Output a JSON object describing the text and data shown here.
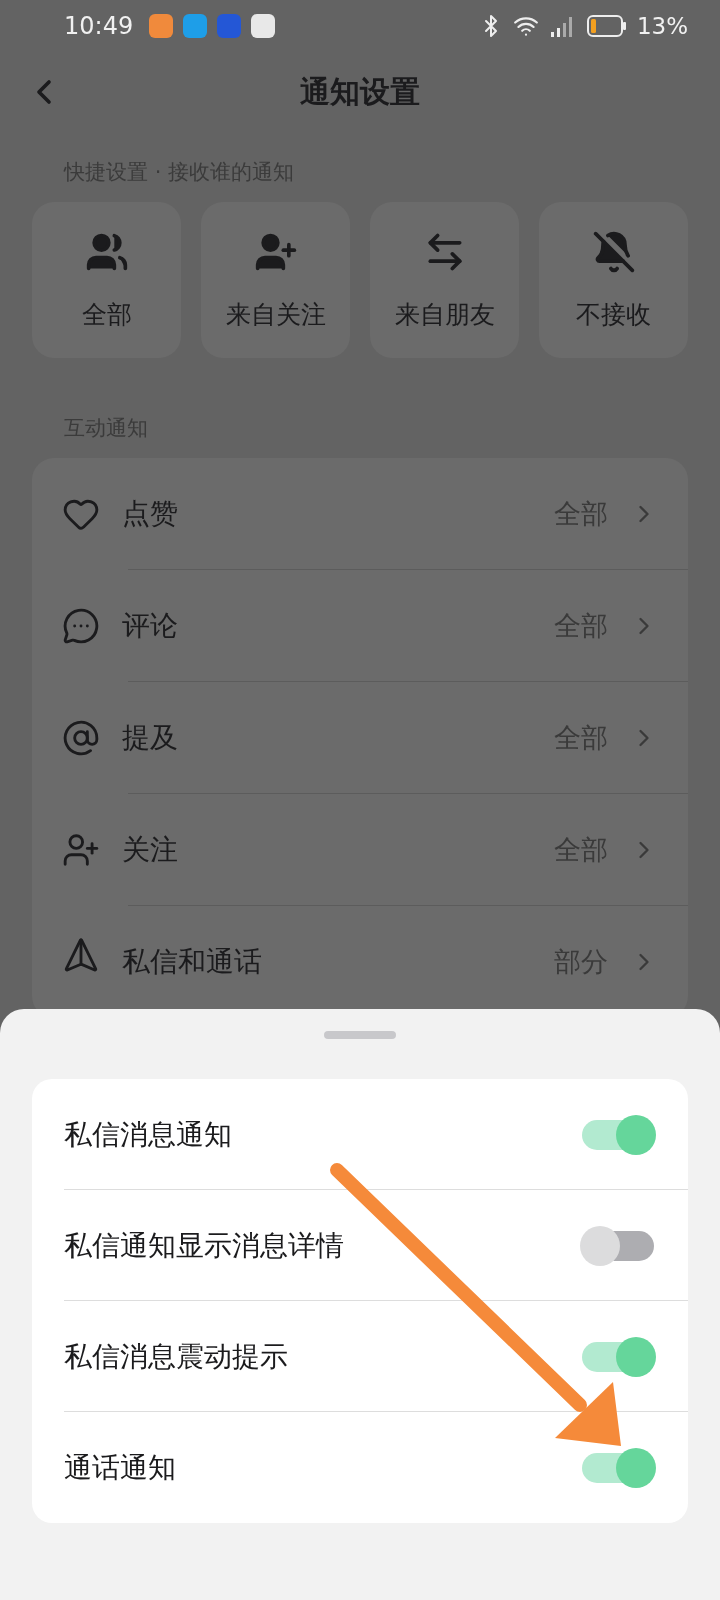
{
  "status_bar": {
    "time": "10:49",
    "battery": "13%",
    "notification_icons": [
      {
        "color": "#f08a3c"
      },
      {
        "color": "#1e9ee8"
      },
      {
        "color": "#2457d6"
      },
      {
        "color": "#e8e8e8"
      }
    ]
  },
  "header": {
    "title": "通知设置"
  },
  "quick_settings": {
    "title": "快捷设置 · 接收谁的通知",
    "options": [
      {
        "label": "全部",
        "kind": "all"
      },
      {
        "label": "来自关注",
        "kind": "following"
      },
      {
        "label": "来自朋友",
        "kind": "friends"
      },
      {
        "label": "不接收",
        "kind": "none"
      }
    ]
  },
  "interaction": {
    "title": "互动通知",
    "items": [
      {
        "label": "点赞",
        "value": "全部",
        "kind": "like"
      },
      {
        "label": "评论",
        "value": "全部",
        "kind": "comment"
      },
      {
        "label": "提及",
        "value": "全部",
        "kind": "mention"
      },
      {
        "label": "关注",
        "value": "全部",
        "kind": "follow"
      },
      {
        "label": "私信和通话",
        "value": "部分",
        "kind": "message"
      }
    ]
  },
  "sheet": {
    "toggles": [
      {
        "label": "私信消息通知",
        "on": true
      },
      {
        "label": "私信通知显示消息详情",
        "on": false
      },
      {
        "label": "私信消息震动提示",
        "on": true
      },
      {
        "label": "通话通知",
        "on": true
      }
    ]
  }
}
